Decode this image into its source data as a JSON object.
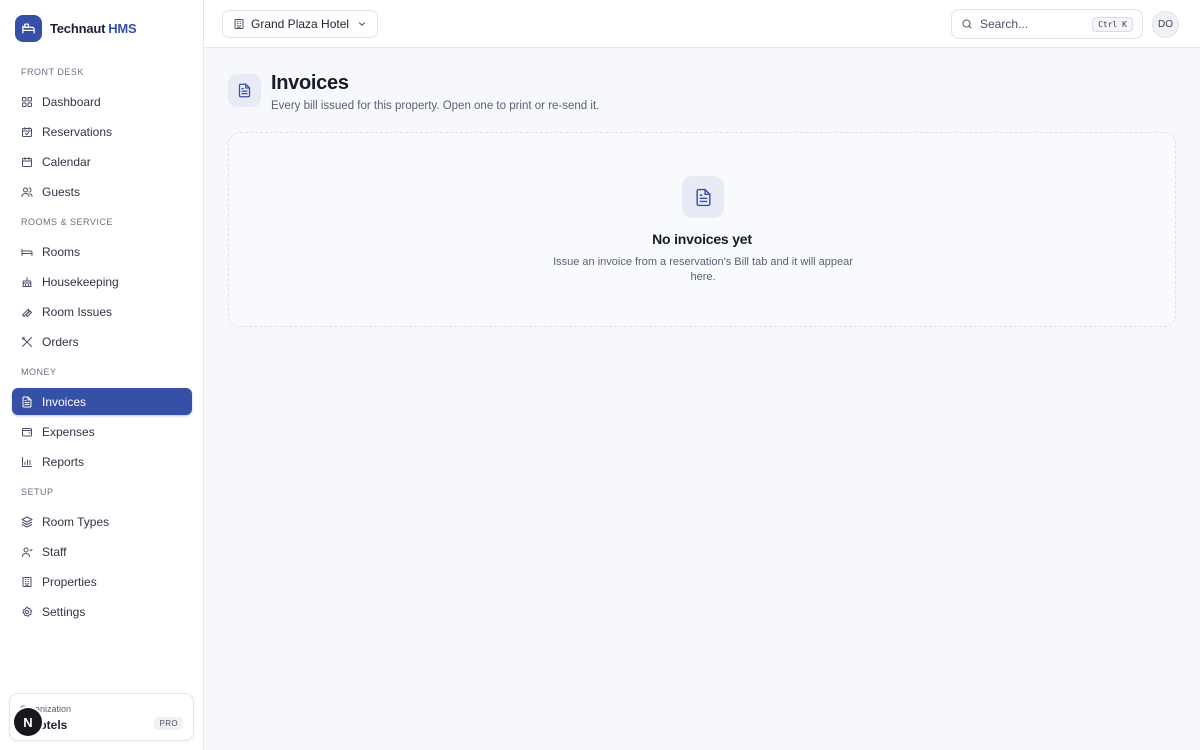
{
  "brand": {
    "name": "Technaut",
    "accent": "HMS",
    "color": "#3650a8"
  },
  "sidebar": {
    "sections": [
      {
        "label": "FRONT DESK",
        "items": [
          {
            "label": "Dashboard",
            "icon": "dashboard-icon"
          },
          {
            "label": "Reservations",
            "icon": "reservations-icon"
          },
          {
            "label": "Calendar",
            "icon": "calendar-icon"
          },
          {
            "label": "Guests",
            "icon": "guests-icon"
          }
        ]
      },
      {
        "label": "ROOMS & SERVICE",
        "items": [
          {
            "label": "Rooms",
            "icon": "bed-icon"
          },
          {
            "label": "Housekeeping",
            "icon": "housekeeping-icon"
          },
          {
            "label": "Room Issues",
            "icon": "wrench-icon"
          },
          {
            "label": "Orders",
            "icon": "utensils-icon"
          }
        ]
      },
      {
        "label": "MONEY",
        "items": [
          {
            "label": "Invoices",
            "icon": "invoice-icon",
            "active": true
          },
          {
            "label": "Expenses",
            "icon": "wallet-icon"
          },
          {
            "label": "Reports",
            "icon": "bar-chart-icon"
          }
        ]
      },
      {
        "label": "SETUP",
        "items": [
          {
            "label": "Room Types",
            "icon": "layers-icon"
          },
          {
            "label": "Staff",
            "icon": "staff-icon"
          },
          {
            "label": "Properties",
            "icon": "building-icon"
          },
          {
            "label": "Settings",
            "icon": "gear-icon"
          }
        ]
      }
    ]
  },
  "org": {
    "label": "Organization",
    "name": "o Hotels",
    "badge": "PRO",
    "avatar": "N"
  },
  "topbar": {
    "property": "Grand Plaza Hotel",
    "search_placeholder": "Search...",
    "shortcut": "Ctrl K",
    "user_initials": "DO"
  },
  "page": {
    "title": "Invoices",
    "subtitle": "Every bill issued for this property. Open one to print or re-send it."
  },
  "empty_state": {
    "title": "No invoices yet",
    "text": "Issue an invoice from a reservation's Bill tab and it will appear here."
  }
}
